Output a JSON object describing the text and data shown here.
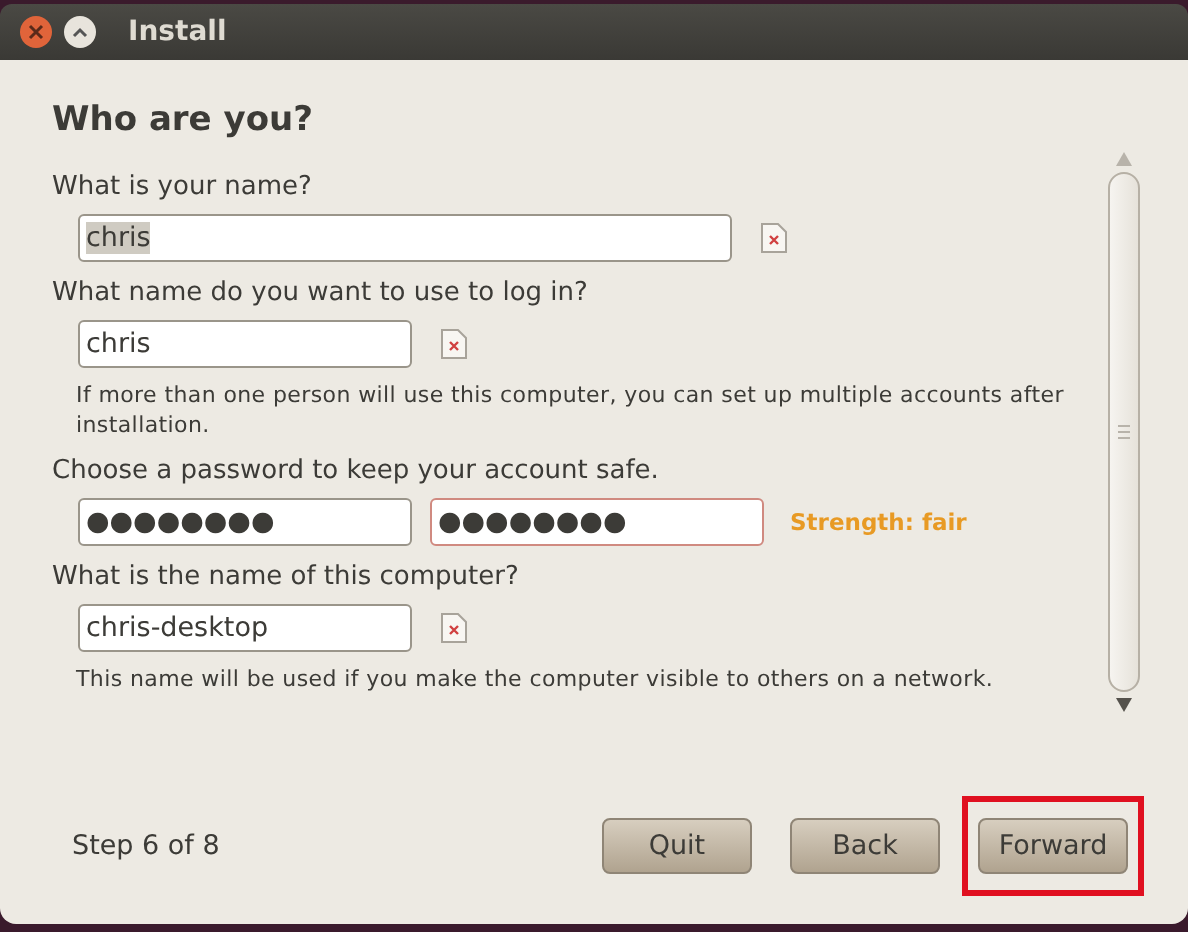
{
  "window": {
    "title": "Install"
  },
  "heading": "Who are you?",
  "sections": [
    {
      "label": "What is your name?",
      "fields": [
        {
          "value": "chris",
          "kind": "wide",
          "selected": true,
          "error": false
        }
      ],
      "icon": true
    },
    {
      "label": "What name do you want to use to log in?",
      "fields": [
        {
          "value": "chris",
          "kind": "short",
          "selected": false,
          "error": false
        }
      ],
      "icon": true,
      "hint": "If more than one person will use this computer, you can set up multiple accounts after installation."
    },
    {
      "label": "Choose a password to keep your account safe.",
      "fields": [
        {
          "value": "●●●●●●●●",
          "kind": "short",
          "selected": false,
          "error": false
        },
        {
          "value": "●●●●●●●●",
          "kind": "short",
          "selected": false,
          "error": true
        }
      ],
      "strength": "Strength: fair"
    },
    {
      "label": "What is the name of this computer?",
      "fields": [
        {
          "value": "chris-desktop",
          "kind": "short",
          "selected": false,
          "error": false
        }
      ],
      "icon": true,
      "hint": "This name will be used if you make the computer visible to others on a network."
    }
  ],
  "step": "Step 6 of 8",
  "buttons": [
    {
      "label": "Quit",
      "highlighted": false
    },
    {
      "label": "Back",
      "highlighted": false
    },
    {
      "label": "Forward",
      "highlighted": true
    }
  ]
}
